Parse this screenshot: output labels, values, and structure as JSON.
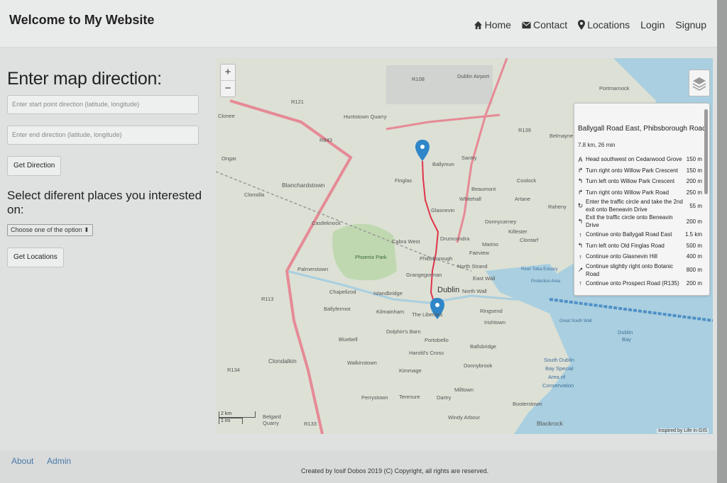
{
  "brand": "Welcome to My Website",
  "nav": {
    "home": "Home",
    "contact": "Contact",
    "locations": "Locations",
    "login": "Login",
    "signup": "Signup"
  },
  "form": {
    "heading": "Enter map direction:",
    "start_placeholder": "Enter start point direction (latitude, longitude)",
    "end_placeholder": "Enter end direction (latitude, longitude)",
    "get_direction": "Get Direction",
    "places_heading": "Select diferent places you interested on:",
    "select_value": "Choose one of the option",
    "get_locations": "Get Locations"
  },
  "map": {
    "zoom_in": "+",
    "zoom_out": "−",
    "labels": [
      "R108",
      "Dublin Airport",
      "Portmarnock",
      "R121",
      "Clonee",
      "Huntstown Quarry",
      "R139",
      "Belmayne",
      "R843",
      "Santry",
      "Ongar",
      "Ballymun",
      "Blanchardstown",
      "Finglas",
      "Coolock",
      "Beaumont",
      "Whitehall",
      "Artane",
      "Raheny",
      "Clonsilla",
      "Castleknock",
      "Glasnevin",
      "Donnycarney",
      "Killester",
      "Cabra West",
      "Drumcondra",
      "Marino",
      "Clontarf",
      "Phoenix Park",
      "Phibsborough",
      "Fairview",
      "North Strand",
      "Palmerstown",
      "Grangegorman",
      "East Wall",
      "Chapelizod",
      "Islandbridge",
      "Dublin",
      "North Wall",
      "R113",
      "Ballyfermot",
      "Kilmainham",
      "The Liberties",
      "Ringsend",
      "Irishtown",
      "Dolphin's Barn",
      "Portobello",
      "Bluebell",
      "Ballsbridge",
      "Dublin Bay",
      "Harold's Cross",
      "Clondalkin",
      "Walkinstown",
      "Donnybrook",
      "R134",
      "Kimmage",
      "South Dublin Bay Special Area of Conservation",
      "Perrystown",
      "Terenure",
      "Dartry",
      "Milltown",
      "Booterstown",
      "Windy Arbour",
      "Belgard Quarry",
      "R133",
      "Blackrock",
      "River Tolka Estuary Special Protection Area",
      "Great South Wall"
    ],
    "scale_km": "2 km",
    "scale_mi": "1 mi",
    "attribution": "Inspired by Life in GIS",
    "route": {
      "title": "Ballygall Road East, Phibsborough Road",
      "summary": "7.8 km, 26 min",
      "steps": [
        {
          "icon": "A",
          "text": "Head southwest on Cedarwood Grove",
          "dist": "150 m"
        },
        {
          "icon": "↱",
          "text": "Turn right onto Willow Park Crescent",
          "dist": "150 m"
        },
        {
          "icon": "↰",
          "text": "Turn left onto Willow Park Crescent",
          "dist": "200 m"
        },
        {
          "icon": "↱",
          "text": "Turn right onto Willow Park Road",
          "dist": "250 m"
        },
        {
          "icon": "↻",
          "text": "Enter the traffic circle and take the 2nd exit onto Beneavin Drive",
          "dist": "55 m"
        },
        {
          "icon": "↰",
          "text": "Exit the traffic circle onto Beneavin Drive",
          "dist": "200 m"
        },
        {
          "icon": "↑",
          "text": "Continue onto Ballygall Road East",
          "dist": "1.5 km"
        },
        {
          "icon": "↰",
          "text": "Turn left onto Old Finglas Road",
          "dist": "500 m"
        },
        {
          "icon": "↑",
          "text": "Continue onto Glasnevin Hill",
          "dist": "400 m"
        },
        {
          "icon": "↗",
          "text": "Continue slightly right onto Botanic Road",
          "dist": "800 m"
        },
        {
          "icon": "↑",
          "text": "Continue onto Prospect Road (R135)",
          "dist": "200 m"
        }
      ]
    }
  },
  "footer": {
    "about": "About",
    "admin": "Admin",
    "copyright": "Created by Iosif Dobos 2019 (C) Copyright, all rights are reserved."
  },
  "colors": {
    "route": "#e0334a",
    "marker": "#2f86c8",
    "water": "#a9cfe0",
    "land": "#dfe2d6",
    "park": "#bfd8b0"
  }
}
